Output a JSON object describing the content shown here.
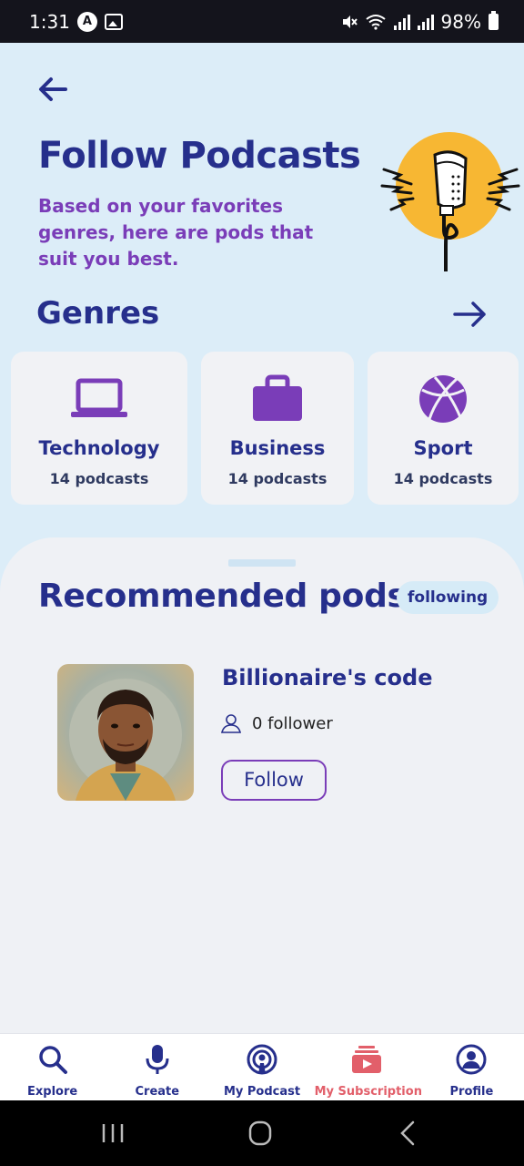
{
  "status_bar": {
    "time": "1:31",
    "battery": "98%"
  },
  "header": {
    "title": "Follow Podcasts",
    "subtitle": "Based on your favorites genres, here are pods that suit you best."
  },
  "genres": {
    "title": "Genres",
    "items": [
      {
        "name": "Technology",
        "count": "14 podcasts",
        "icon": "laptop-icon"
      },
      {
        "name": "Business",
        "count": "14 podcasts",
        "icon": "briefcase-icon"
      },
      {
        "name": "Sport",
        "count": "14 podcasts",
        "icon": "basketball-icon"
      }
    ]
  },
  "recommended": {
    "title": "Recommended pods",
    "badge": "following",
    "pods": [
      {
        "name": "Billionaire's code",
        "followers": "0 follower",
        "follow_label": "Follow"
      }
    ]
  },
  "bottom_nav": {
    "items": [
      {
        "label": "Explore",
        "icon": "search-icon"
      },
      {
        "label": "Create",
        "icon": "microphone-icon"
      },
      {
        "label": "My Podcast",
        "icon": "podcast-icon"
      },
      {
        "label": "My Subscription",
        "icon": "subscription-icon",
        "active": true
      },
      {
        "label": "Profile",
        "icon": "profile-icon"
      }
    ]
  },
  "colors": {
    "primary": "#262f8c",
    "accent": "#7a3db8",
    "active_nav": "#e25f6a",
    "background": "#dcedf8"
  }
}
